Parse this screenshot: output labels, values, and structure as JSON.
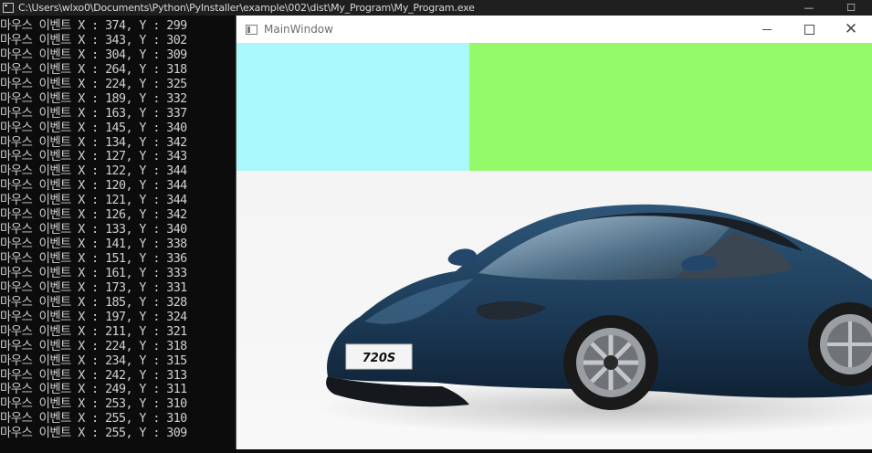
{
  "console": {
    "title": "C:\\Users\\wlxo0\\Documents\\Python\\PyInstaller\\example\\002\\dist\\My_Program\\My_Program.exe",
    "controls": {
      "minimize": "—",
      "maximize": "☐"
    },
    "lines": [
      "마우스 이벤트 X : 374, Y : 299",
      "마우스 이벤트 X : 343, Y : 302",
      "마우스 이벤트 X : 304, Y : 309",
      "마우스 이벤트 X : 264, Y : 318",
      "마우스 이벤트 X : 224, Y : 325",
      "마우스 이벤트 X : 189, Y : 332",
      "마우스 이벤트 X : 163, Y : 337",
      "마우스 이벤트 X : 145, Y : 340",
      "마우스 이벤트 X : 134, Y : 342",
      "마우스 이벤트 X : 127, Y : 343",
      "마우스 이벤트 X : 122, Y : 344",
      "마우스 이벤트 X : 120, Y : 344",
      "마우스 이벤트 X : 121, Y : 344",
      "마우스 이벤트 X : 126, Y : 342",
      "마우스 이벤트 X : 133, Y : 340",
      "마우스 이벤트 X : 141, Y : 338",
      "마우스 이벤트 X : 151, Y : 336",
      "마우스 이벤트 X : 161, Y : 333",
      "마우스 이벤트 X : 173, Y : 331",
      "마우스 이벤트 X : 185, Y : 328",
      "마우스 이벤트 X : 197, Y : 324",
      "마우스 이벤트 X : 211, Y : 321",
      "마우스 이벤트 X : 224, Y : 318",
      "마우스 이벤트 X : 234, Y : 315",
      "마우스 이벤트 X : 242, Y : 313",
      "마우스 이벤트 X : 249, Y : 311",
      "마우스 이벤트 X : 253, Y : 310",
      "마우스 이벤트 X : 255, Y : 310",
      "마우스 이벤트 X : 255, Y : 309"
    ]
  },
  "main_window": {
    "title": "MainWindow",
    "controls": {
      "close": "✕"
    },
    "panels": {
      "cyan_color": "#a8f8fc",
      "green_color": "#95fa6a"
    },
    "car": {
      "plate_text": "720S",
      "body_color": "#1f3f5c"
    }
  }
}
